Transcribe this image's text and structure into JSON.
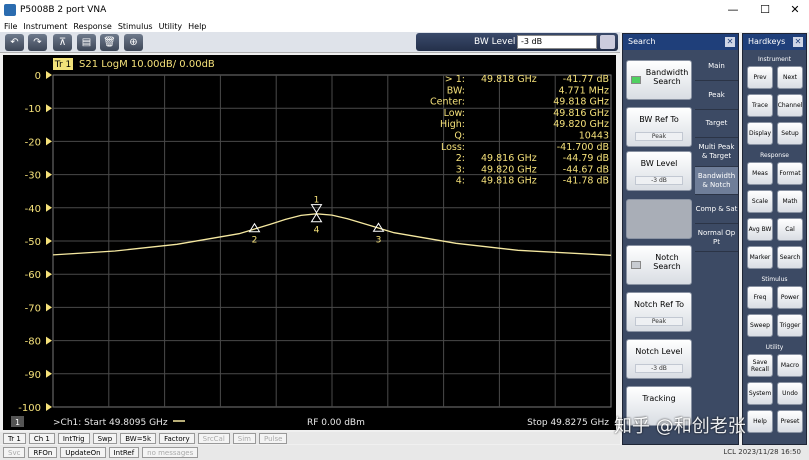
{
  "window": {
    "title": "P5008B 2 port VNA",
    "controls": [
      "—",
      "☐",
      "✕"
    ]
  },
  "menu": [
    "File",
    "Instrument",
    "Response",
    "Stimulus",
    "Utility",
    "Help"
  ],
  "toolbar": {
    "buttons": [
      {
        "name": "undo",
        "glyph": "↶"
      },
      {
        "name": "redo",
        "glyph": "↷"
      },
      {
        "name": "marker",
        "glyph": "⊼"
      },
      {
        "name": "save",
        "glyph": "▤"
      },
      {
        "name": "delete",
        "glyph": "🗑"
      },
      {
        "name": "zoom",
        "glyph": "⊕"
      }
    ],
    "bw_level_label": "BW Level",
    "bw_level_value": "-3 dB"
  },
  "trace": {
    "tag": "Tr 1",
    "desc": "S21 LogM 10.00dB/  0.00dB",
    "channel_number": "1"
  },
  "markers_readout": [
    {
      "label": "> 1:",
      "freq": "49.818  GHz",
      "val": "-41.77 dB"
    },
    {
      "label": "BW:",
      "freq": "",
      "val": "4.771 MHz"
    },
    {
      "label": "Center:",
      "freq": "",
      "val": "49.818 GHz"
    },
    {
      "label": "Low:",
      "freq": "",
      "val": "49.816 GHz"
    },
    {
      "label": "High:",
      "freq": "",
      "val": "49.820 GHz"
    },
    {
      "label": "Q:",
      "freq": "",
      "val": "10443"
    },
    {
      "label": "Loss:",
      "freq": "",
      "val": "-41.700 dB"
    },
    {
      "label": "2:",
      "freq": "49.816  GHz",
      "val": "-44.79 dB"
    },
    {
      "label": "3:",
      "freq": "49.820  GHz",
      "val": "-44.67 dB"
    },
    {
      "label": "4:",
      "freq": "49.818  GHz",
      "val": "-41.78 dB"
    }
  ],
  "chart_data": {
    "type": "line",
    "ylabel_ticks": [
      "0",
      "-10",
      "-20",
      "-30",
      "-40",
      "-50",
      "-60",
      "-70",
      "-80",
      "-90",
      "-100"
    ],
    "ylim": [
      -100,
      0
    ],
    "xlim": [
      49.8095,
      49.8275
    ],
    "grid": true,
    "series": [
      {
        "x": [
          49.8095,
          49.8115,
          49.8135,
          49.8155,
          49.8165,
          49.817,
          49.8175,
          49.818,
          49.8185,
          49.819,
          49.8195,
          49.8205,
          49.8225,
          49.8245,
          49.8275
        ],
        "y": [
          -54.2,
          -53.0,
          -51.0,
          -47.8,
          -45.0,
          -43.5,
          -42.3,
          -41.8,
          -42.2,
          -43.3,
          -44.7,
          -47.5,
          -50.7,
          -52.8,
          -54.3
        ]
      }
    ],
    "markers": [
      {
        "id": "1",
        "x": 49.818,
        "y": -41.77
      },
      {
        "id": "2",
        "x": 49.816,
        "y": -44.79
      },
      {
        "id": "3",
        "x": 49.82,
        "y": -44.67
      },
      {
        "id": "4",
        "x": 49.818,
        "y": -41.78
      }
    ],
    "start_label": ">Ch1:  Start  49.8095 GHz",
    "rf_label": "RF     0.00 dBm",
    "stop_label": "Stop  49.8275 GHz",
    "line_color": "#f5e8a0",
    "marker_color": "#ffffff",
    "text_color": "#f5e17a"
  },
  "search_panel": {
    "title": "Search",
    "softkeys": [
      {
        "label": "Bandwidth Search",
        "sub": "",
        "led": "on"
      },
      {
        "label": "BW Ref To",
        "sub": "Peak",
        "led": ""
      },
      {
        "label": "BW Level",
        "sub": "-3 dB",
        "led": ""
      },
      {
        "label": "",
        "sub": "",
        "led": ""
      },
      {
        "label": "Notch Search",
        "sub": "",
        "led": "off"
      },
      {
        "label": "Notch Ref To",
        "sub": "Peak",
        "led": ""
      },
      {
        "label": "Notch Level",
        "sub": "-3 dB",
        "led": ""
      },
      {
        "label": "Tracking",
        "sub": "",
        "led": ""
      }
    ],
    "tabs": [
      "Main",
      "Peak",
      "Target",
      "Multi Peak & Target",
      "Bandwidth & Notch",
      "Comp & Sat",
      "Normal Op Pt"
    ]
  },
  "hardkeys": {
    "title": "Hardkeys",
    "groups": [
      {
        "name": "Instrument",
        "keys": [
          "Prev",
          "Next",
          "Trace",
          "Channel",
          "Display",
          "Setup"
        ]
      },
      {
        "name": "Response",
        "keys": [
          "Meas",
          "Format",
          "Scale",
          "Math",
          "Avg BW",
          "Cal",
          "Marker",
          "Search"
        ]
      },
      {
        "name": "Stimulus",
        "keys": [
          "Freq",
          "Power",
          "Sweep",
          "Trigger"
        ]
      },
      {
        "name": "Utility",
        "keys": [
          "Save Recall",
          "Macro",
          "System",
          "Undo",
          "Help",
          "Preset"
        ]
      }
    ]
  },
  "status": {
    "row1": [
      {
        "t": "Tr 1",
        "dim": false
      },
      {
        "t": "Ch 1",
        "dim": false
      },
      {
        "t": "IntTrig",
        "dim": false
      },
      {
        "t": "Swp",
        "dim": false
      },
      {
        "t": "BW=5k",
        "dim": false
      },
      {
        "t": "Factory",
        "dim": false
      },
      {
        "t": "SrcCal",
        "dim": true
      },
      {
        "t": "Sim",
        "dim": true
      },
      {
        "t": "Pulse",
        "dim": true
      }
    ],
    "row2": [
      {
        "t": "Svc",
        "dim": true
      },
      {
        "t": "RFOn",
        "dim": false
      },
      {
        "t": "UpdateOn",
        "dim": false
      },
      {
        "t": "IntRef",
        "dim": false
      },
      {
        "t": "no messages",
        "dim": true
      }
    ],
    "right": "LCL     2023/11/28 16:50"
  },
  "watermark": "知乎 @和创老张"
}
